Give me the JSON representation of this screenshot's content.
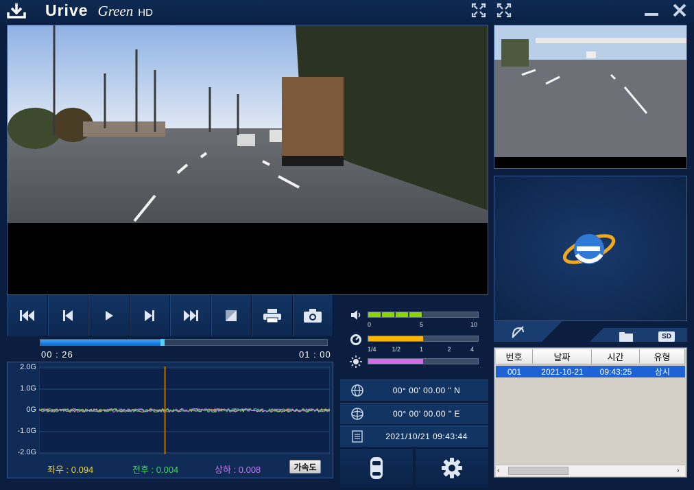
{
  "app": {
    "brand": "Urive",
    "edition": "Green",
    "quality": "HD"
  },
  "playback": {
    "current_time": "00 : 26",
    "total_time": "01 : 00",
    "progress_fraction": 0.433
  },
  "gsensor": {
    "y_tick_labels": [
      "2.0G",
      "1.0G",
      "0G",
      "-1.0G",
      "-2.0G"
    ],
    "x_label": "좌우 : 0.094",
    "y_label": "전후 : 0.004",
    "z_label": "상하 : 0.008",
    "accel_button": "가속도",
    "colors": {
      "x": "#e8d23a",
      "y": "#46d46a",
      "z": "#c27cf0",
      "cursor": "#e68a00"
    }
  },
  "volume": {
    "ticks": [
      "0",
      "5",
      "10"
    ],
    "level_fraction": 0.5,
    "color": "#8dd400"
  },
  "speed": {
    "ticks": [
      "1/4",
      "1/2",
      "1",
      "2",
      "4"
    ],
    "level_fraction": 0.5,
    "color": "#ffb400"
  },
  "brightness": {
    "level_fraction": 0.5,
    "color": "#d46ce8"
  },
  "gps": {
    "latitude": "00° 00'  00.00 \" N",
    "longitude": "00° 00'  00.00 \" E",
    "datetime": "2021/10/21 09:43:44"
  },
  "file_list": {
    "columns": [
      "번호",
      "날짜",
      "시간",
      "유형"
    ],
    "rows": [
      {
        "no": "001",
        "date": "2021-10-21",
        "time": "09:43:25",
        "type": "상시"
      }
    ],
    "tab_sd_label": "SD"
  }
}
